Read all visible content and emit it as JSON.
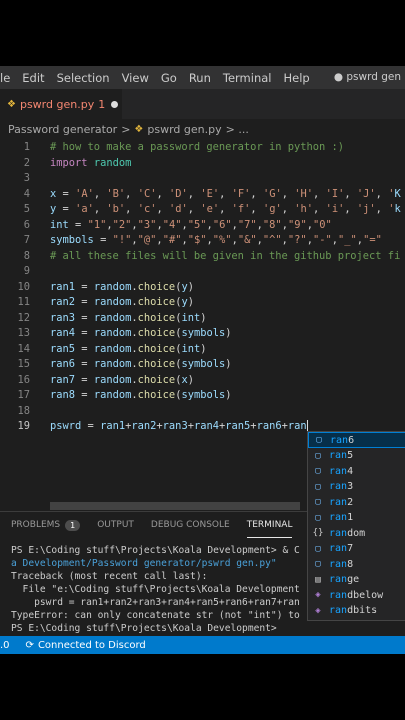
{
  "menu": {
    "items": [
      "le",
      "Edit",
      "Selection",
      "View",
      "Go",
      "Run",
      "Terminal",
      "Help"
    ],
    "window_title": "● pswrd gen"
  },
  "tab": {
    "label": "pswrd gen.py",
    "problem_count": "1"
  },
  "breadcrumb": {
    "folder": "Password generator",
    "sep": ">",
    "file": "pswrd gen.py",
    "more": "> ..."
  },
  "editor": {
    "lines": [
      {
        "n": "1",
        "text": "# how to make a password generator in python :)"
      },
      {
        "n": "2",
        "text": "import random"
      },
      {
        "n": "3",
        "text": ""
      },
      {
        "n": "4",
        "text": "x = 'A', 'B', 'C', 'D', 'E', 'F', 'G', 'H', 'I', 'J', 'K"
      },
      {
        "n": "5",
        "text": "y = 'a', 'b', 'c', 'd', 'e', 'f', 'g', 'h', 'i', 'j', 'k"
      },
      {
        "n": "6",
        "text": "int = \"1\",\"2\",\"3\",\"4\",\"5\",\"6\",\"7\",\"8\",\"9\",\"0\""
      },
      {
        "n": "7",
        "text": "symbols = \"!\",\"@\",\"#\",\"$\",\"%\",\"&\",\"^\",\"?\",\"-\",\"_\",\"=\""
      },
      {
        "n": "8",
        "text": "# all these files will be given in the github project fi"
      },
      {
        "n": "9",
        "text": ""
      },
      {
        "n": "10",
        "text": "ran1 = random.choice(y)"
      },
      {
        "n": "11",
        "text": "ran2 = random.choice(y)"
      },
      {
        "n": "12",
        "text": "ran3 = random.choice(int)"
      },
      {
        "n": "13",
        "text": "ran4 = random.choice(symbols)"
      },
      {
        "n": "14",
        "text": "ran5 = random.choice(int)"
      },
      {
        "n": "15",
        "text": "ran6 = random.choice(symbols)"
      },
      {
        "n": "16",
        "text": "ran7 = random.choice(x)"
      },
      {
        "n": "17",
        "text": "ran8 = random.choice(symbols)"
      },
      {
        "n": "18",
        "text": ""
      },
      {
        "n": "19",
        "text": "pswrd = ran1+ran2+ran3+ran4+ran5+ran6+ran"
      }
    ]
  },
  "panel": {
    "tabs": [
      "PROBLEMS",
      "OUTPUT",
      "DEBUG CONSOLE",
      "TERMINAL"
    ],
    "problems_badge": "1",
    "terminal_lines": [
      "PS E:\\Coding stuff\\Projects\\Koala Development> & C",
      "a Development/Password generator/pswrd gen.py\"",
      "Traceback (most recent call last):",
      "  File \"e:\\Coding stuff\\Projects\\Koala Development",
      "    pswrd = ran1+ran2+ran3+ran4+ran5+ran6+ran7+ran",
      "TypeError: can only concatenate str (not \"int\") to",
      "PS E:\\Coding stuff\\Projects\\Koala Development> "
    ]
  },
  "statusbar": {
    "left": ".0",
    "discord": "Connected to Discord"
  },
  "suggest": {
    "items": [
      {
        "kind": "var",
        "label": "ran6"
      },
      {
        "kind": "var",
        "label": "ran5"
      },
      {
        "kind": "var",
        "label": "ran4"
      },
      {
        "kind": "var",
        "label": "ran3"
      },
      {
        "kind": "var",
        "label": "ran2"
      },
      {
        "kind": "var",
        "label": "ran1"
      },
      {
        "kind": "module",
        "label": "random"
      },
      {
        "kind": "var",
        "label": "ran7"
      },
      {
        "kind": "var",
        "label": "ran8"
      },
      {
        "kind": "keyword",
        "label": "range"
      },
      {
        "kind": "method",
        "label": "randbelow"
      },
      {
        "kind": "method",
        "label": "randbits"
      }
    ],
    "typed_prefix": "ran"
  },
  "colors": {
    "comment": "#6a9955",
    "keyword": "#c586c0",
    "variable": "#9cdcfe",
    "string": "#ce9178",
    "function": "#dcdcaa",
    "operator": "#d4d4d4",
    "accent": "#007acc"
  }
}
